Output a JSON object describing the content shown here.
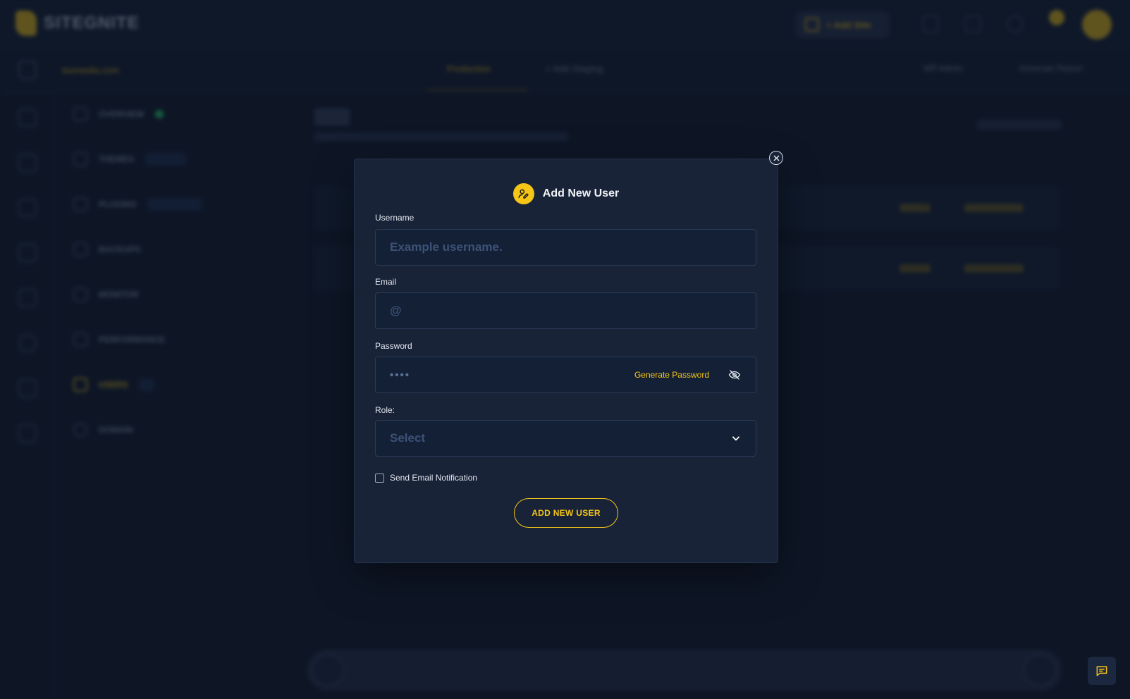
{
  "app": {
    "logo_text": "SITEGNITE",
    "add_site_label": "+ Add Site",
    "domain": "taxmedia.com",
    "tab_production": "Production",
    "tab_staging": "+ Add Staging",
    "wp_admin_label": "WP Admin",
    "generate_report_label": "Generate Report",
    "sidebar": [
      "OVERVIEW",
      "THEMES",
      "PLUGINS",
      "BACKUPS",
      "MONITOR",
      "PERFORMANCE",
      "USERS",
      "DOMAIN"
    ],
    "users_title": "Users",
    "users_subtitle": "Add, delete and modify the roles of listed users below",
    "add_new_user_link": "Add New user",
    "rows": [
      {
        "action": "Edit",
        "role": "Administrator"
      },
      {
        "action": "Edit",
        "role": "Administrator"
      }
    ],
    "footer_text": "Select all"
  },
  "modal": {
    "title": "Add New User",
    "username": {
      "label": "Username",
      "placeholder": "Example username.",
      "value": ""
    },
    "email": {
      "label": "Email",
      "placeholder": "@",
      "value": ""
    },
    "password": {
      "label": "Password",
      "masked": "••••",
      "generate_label": "Generate Password"
    },
    "role": {
      "label": "Role:",
      "selected": "Select"
    },
    "notify_label": "Send Email Notification",
    "submit_label": "ADD NEW USER"
  },
  "colors": {
    "accent": "#f5c518",
    "background": "#111a2c",
    "modal_bg": "#182338"
  },
  "icons": {
    "close": "close-icon",
    "header": "user-edit-icon",
    "password_toggle": "eye-off-icon",
    "role_dropdown": "chevron-down-icon",
    "chat": "chat-icon"
  }
}
